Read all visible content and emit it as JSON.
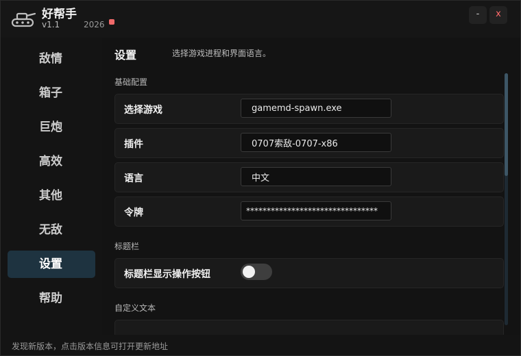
{
  "app": {
    "title": "好帮手",
    "version": "v1.1",
    "year": "2026",
    "logo_icon": "tank-icon",
    "minimize_label": "-",
    "close_label": "x",
    "accent_color": "#1e3340",
    "update_dot_color": "#f06a6a"
  },
  "sidebar": {
    "items": [
      {
        "label": "敌情",
        "active": false
      },
      {
        "label": "箱子",
        "active": false
      },
      {
        "label": "巨炮",
        "active": false
      },
      {
        "label": "高效",
        "active": false
      },
      {
        "label": "其他",
        "active": false
      },
      {
        "label": "无敌",
        "active": false
      },
      {
        "label": "设置",
        "active": true
      },
      {
        "label": "帮助",
        "active": false
      }
    ]
  },
  "main": {
    "title": "设置",
    "description": "选择游戏进程和界面语言。",
    "sections": {
      "basic": "基础配置",
      "titlebar": "标题栏",
      "custom_text": "自定义文本"
    },
    "fields": {
      "game": {
        "label": "选择游戏",
        "value": "gamemd-spawn.exe"
      },
      "plugin": {
        "label": "插件",
        "value": "0707索敌-0707-x86"
      },
      "language": {
        "label": "语言",
        "value": "中文"
      },
      "token": {
        "label": "令牌",
        "value": "********************************"
      }
    },
    "titlebar_toggle": {
      "label": "标题栏显示操作按钮",
      "on": false
    }
  },
  "footer": {
    "text": "发现新版本，点击版本信息可打开更新地址"
  }
}
